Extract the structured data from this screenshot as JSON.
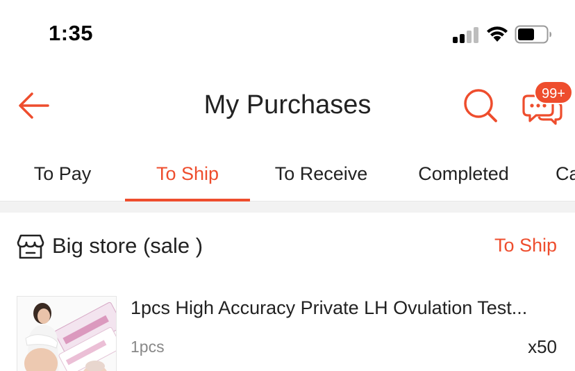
{
  "status_bar": {
    "time": "1:35"
  },
  "header": {
    "title": "My Purchases",
    "chat_badge": "99+"
  },
  "tabs": [
    {
      "label": "To Pay",
      "active": false
    },
    {
      "label": "To Ship",
      "active": true
    },
    {
      "label": "To Receive",
      "active": false
    },
    {
      "label": "Completed",
      "active": false
    },
    {
      "label": "Ca",
      "active": false
    }
  ],
  "order": {
    "store_name": "Big store (sale )",
    "status": "To Ship",
    "product": {
      "title": "1pcs High Accuracy Private LH Ovulation Test...",
      "variant": "1pcs",
      "quantity": "x50"
    }
  },
  "colors": {
    "accent": "#ee4d2d",
    "text": "#222222",
    "muted": "#888888"
  },
  "icons": {
    "back": "arrow-left-icon",
    "search": "search-icon",
    "chat": "chat-bubbles-icon",
    "store": "store-icon"
  }
}
